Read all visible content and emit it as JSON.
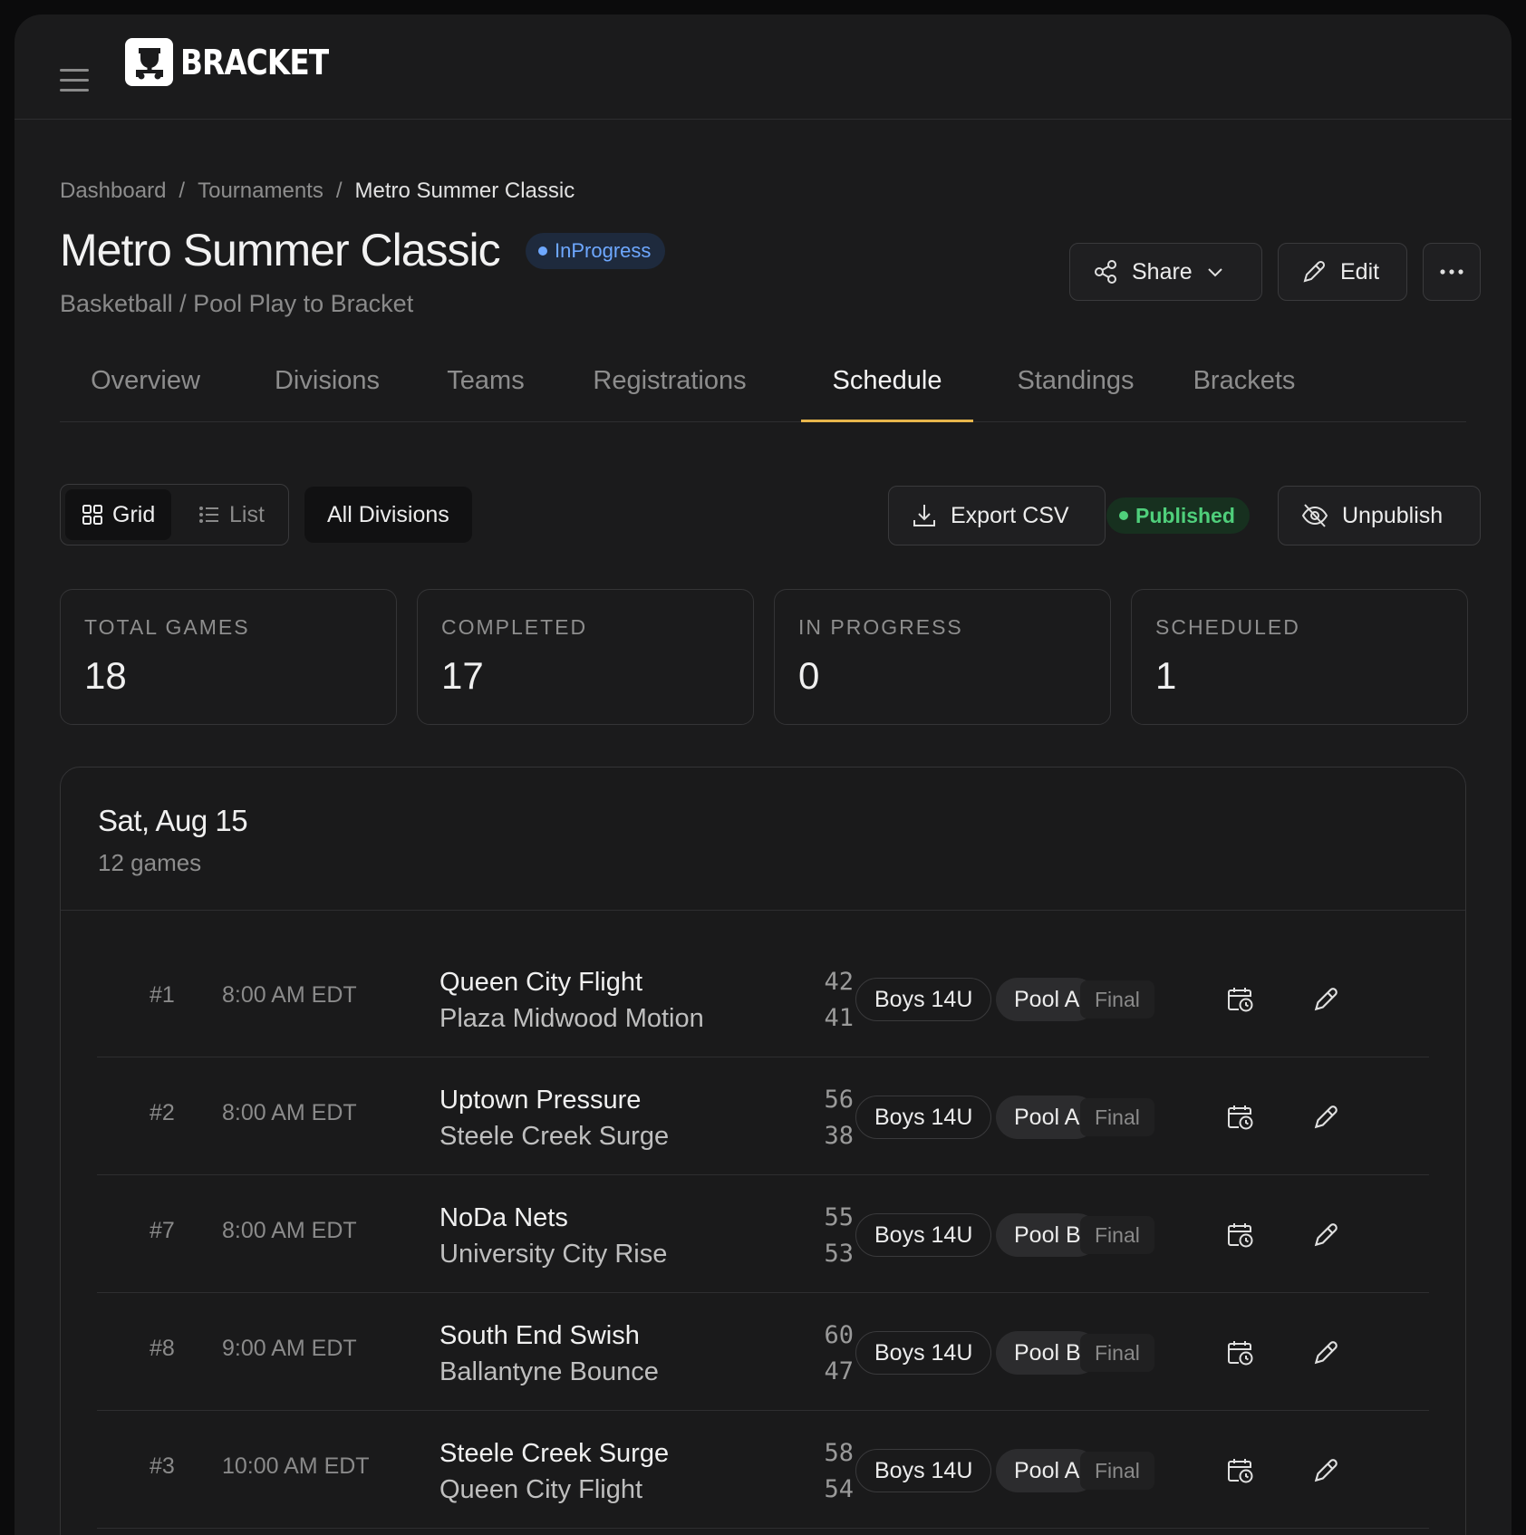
{
  "app": {
    "name": "BRACKET"
  },
  "breadcrumb": [
    "Dashboard",
    "Tournaments",
    "Metro Summer Classic"
  ],
  "tournament": {
    "title": "Metro Summer Classic",
    "status": "InProgress",
    "subtitle": "Basketball / Pool Play to Bracket"
  },
  "header_actions": {
    "share": "Share",
    "edit": "Edit"
  },
  "tabs": [
    "Overview",
    "Divisions",
    "Teams",
    "Registrations",
    "Schedule",
    "Standings",
    "Brackets"
  ],
  "active_tab": "Schedule",
  "toolbar": {
    "grid": "Grid",
    "list": "List",
    "division_filter": "All Divisions",
    "export": "Export CSV",
    "published": "Published",
    "unpublish": "Unpublish"
  },
  "stats": [
    {
      "label": "TOTAL GAMES",
      "value": "18"
    },
    {
      "label": "COMPLETED",
      "value": "17"
    },
    {
      "label": "IN PROGRESS",
      "value": "0"
    },
    {
      "label": "SCHEDULED",
      "value": "1"
    }
  ],
  "day": {
    "date": "Sat, Aug 15",
    "count": "12 games"
  },
  "games": [
    {
      "num": "#1",
      "time": "8:00 AM EDT",
      "home": "Queen City Flight",
      "away": "Plaza Midwood Motion",
      "home_score": "42",
      "away_score": "41",
      "division": "Boys 14U",
      "pool": "Pool A",
      "status": "Final"
    },
    {
      "num": "#2",
      "time": "8:00 AM EDT",
      "home": "Uptown Pressure",
      "away": "Steele Creek Surge",
      "home_score": "56",
      "away_score": "38",
      "division": "Boys 14U",
      "pool": "Pool A",
      "status": "Final"
    },
    {
      "num": "#7",
      "time": "8:00 AM EDT",
      "home": "NoDa Nets",
      "away": "University City Rise",
      "home_score": "55",
      "away_score": "53",
      "division": "Boys 14U",
      "pool": "Pool B",
      "status": "Final"
    },
    {
      "num": "#8",
      "time": "9:00 AM EDT",
      "home": "South End Swish",
      "away": "Ballantyne Bounce",
      "home_score": "60",
      "away_score": "47",
      "division": "Boys 14U",
      "pool": "Pool B",
      "status": "Final"
    },
    {
      "num": "#3",
      "time": "10:00 AM EDT",
      "home": "Steele Creek Surge",
      "away": "Queen City Flight",
      "home_score": "58",
      "away_score": "54",
      "division": "Boys 14U",
      "pool": "Pool A",
      "status": "Final"
    }
  ],
  "icons": [
    "menu-icon",
    "trophy-logo-icon",
    "share-icon",
    "chevron-down-icon",
    "pencil-icon",
    "more-icon",
    "grid-icon",
    "list-icon",
    "download-icon",
    "eye-off-icon",
    "calendar-clock-icon"
  ],
  "colors": {
    "accent_tab": "#e8b64c",
    "status_in_progress": "#6ea8ff",
    "status_published": "#4fcf7b"
  }
}
